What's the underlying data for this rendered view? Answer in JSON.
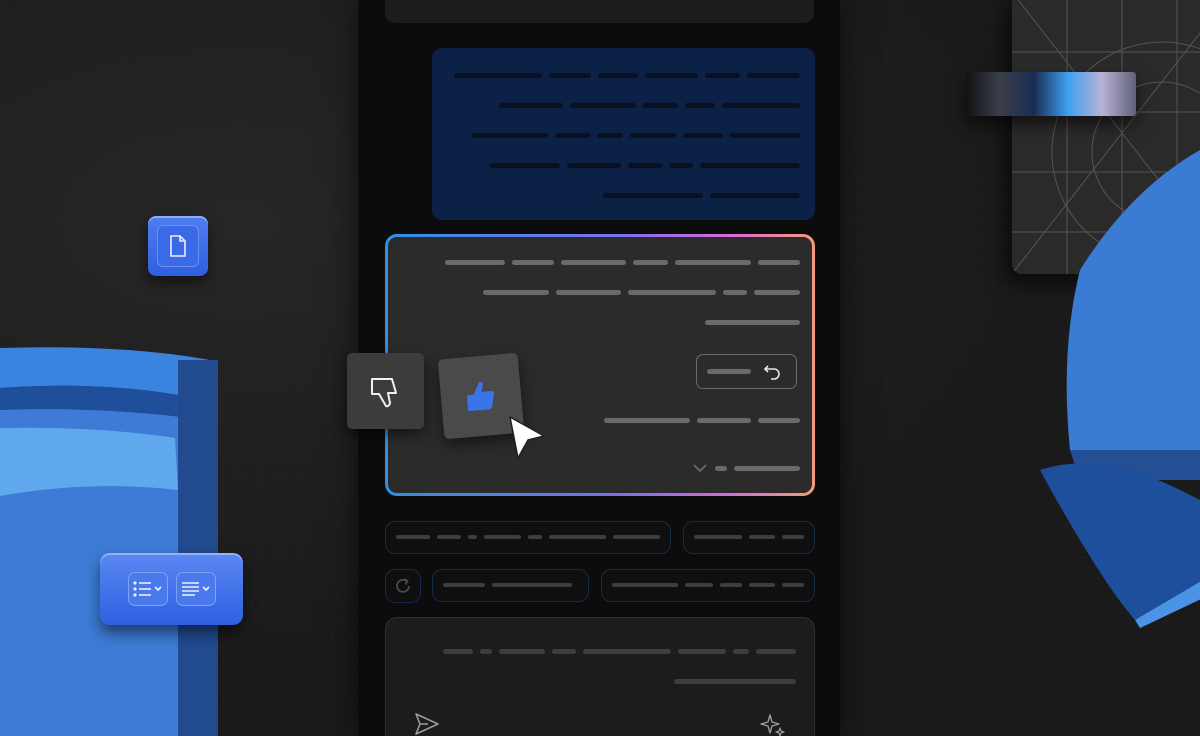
{
  "theme": {
    "background": "#1a1a1b",
    "column": "#0c0c0d",
    "accent_blue": "#2f5fe0",
    "bubble_blue": "#0c2146",
    "gradient_border": [
      "#2f8fe8",
      "#7b6ff0",
      "#d66bd8",
      "#f59a78"
    ],
    "placeholder_gray": "#6a6a6b"
  },
  "icons": {
    "document": "file-icon",
    "bullet_list_format": "bullet-list-icon",
    "paragraph_format": "paragraph-icon",
    "thumbs_down": "thumbs-down-icon",
    "thumbs_up": "thumbs-up-icon",
    "cursor": "mouse-pointer-icon",
    "undo": "undo-icon",
    "expand": "chevron-down-icon",
    "regenerate": "refresh-icon",
    "send": "send-icon",
    "sparkle": "sparkle-icon"
  },
  "feedback": {
    "thumbs_up_selected": true
  }
}
